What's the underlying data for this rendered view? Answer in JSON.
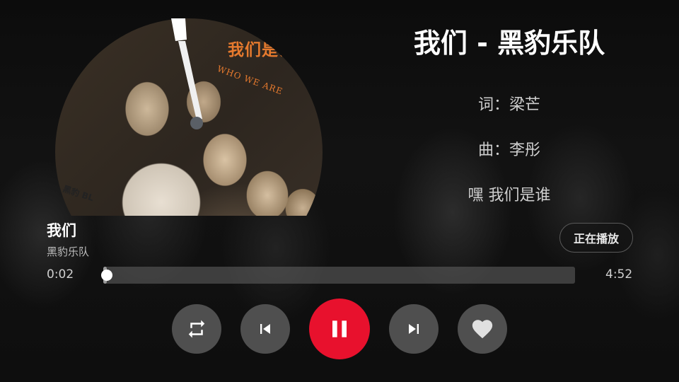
{
  "song": {
    "heading": "我们 - 黑豹乐队",
    "title": "我们",
    "artist": "黑豹乐队"
  },
  "lyrics": [
    "词：梁芒",
    "曲：李彤",
    "嘿 我们是谁"
  ],
  "album_art": {
    "title_text": "我们是谁",
    "subtitle_text": "WHO WE ARE",
    "band_tag": "黑豹 BL"
  },
  "status_button": {
    "label": "正在播放"
  },
  "progress": {
    "elapsed": "0:02",
    "total": "4:52",
    "fraction": 0.007
  },
  "controls": {
    "repeat": "repeat-icon",
    "previous": "skip-previous-icon",
    "play_pause": "pause-icon",
    "next": "skip-next-icon",
    "favorite": "heart-icon"
  },
  "colors": {
    "accent": "#e8112d",
    "album_text": "#e67a2e",
    "background": "#0b0b0b"
  }
}
